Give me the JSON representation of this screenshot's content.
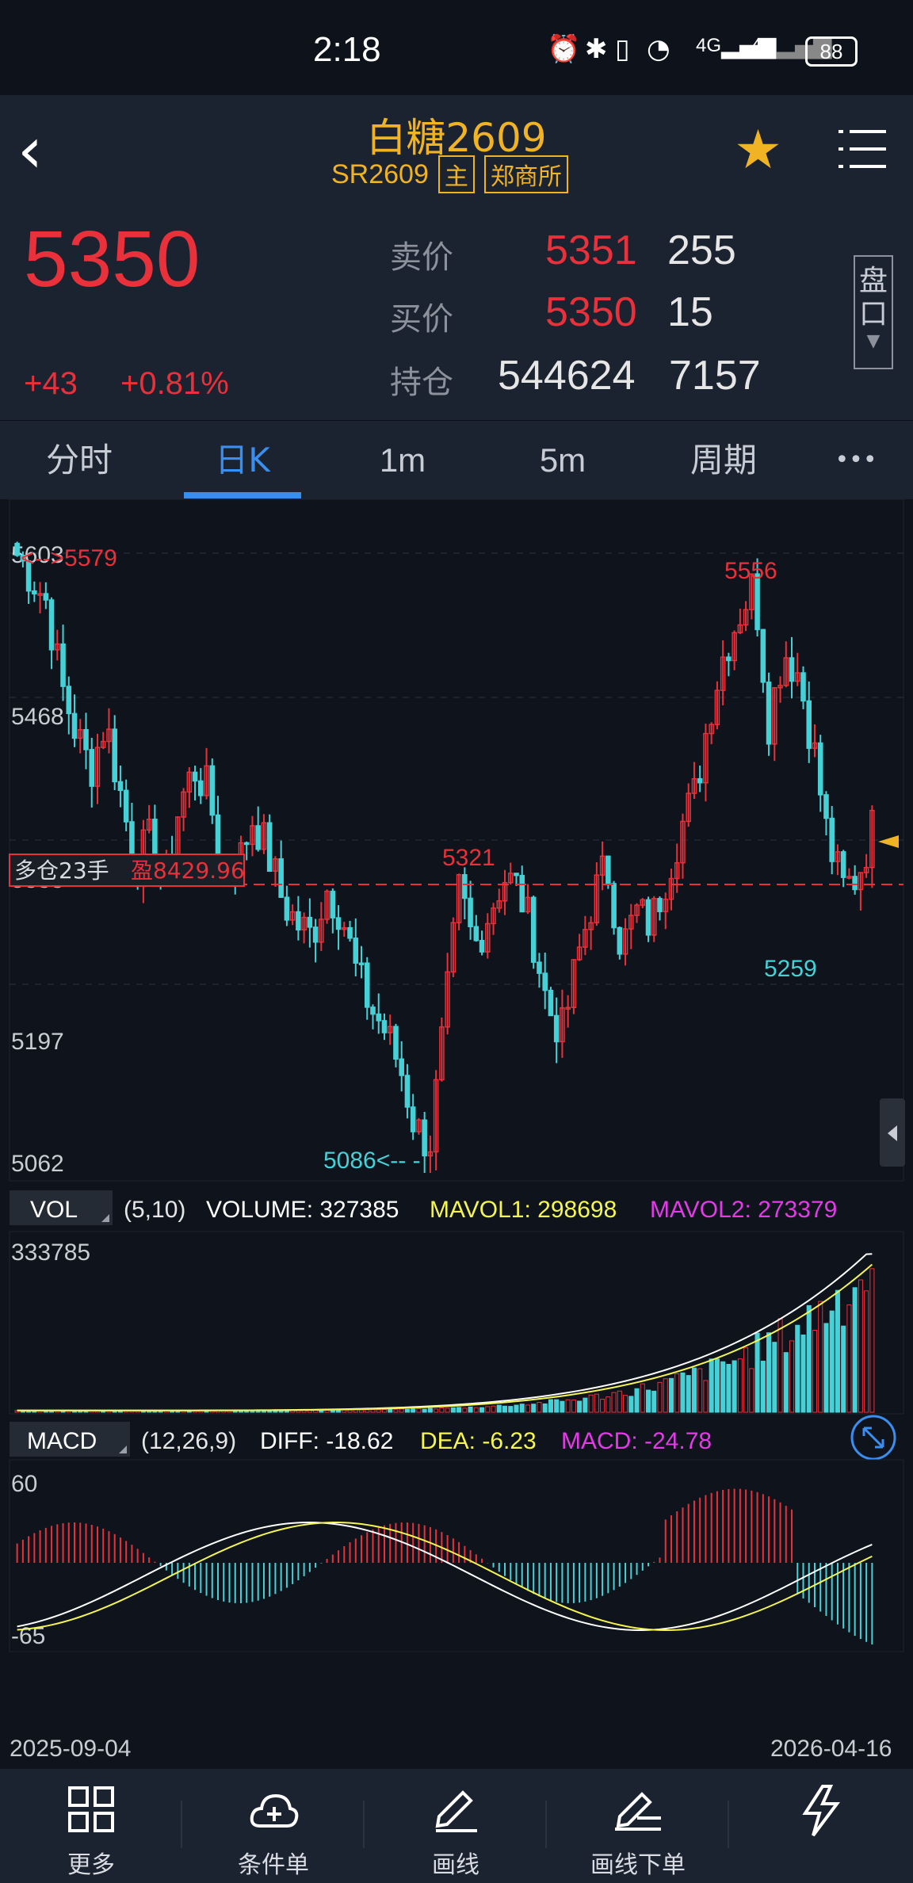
{
  "status_bar": {
    "time": "2:18",
    "battery": "88",
    "net1": "4G",
    "net2": "4G"
  },
  "header": {
    "title": "白糖2609",
    "code": "SR2609",
    "badge_main": "主",
    "badge_exchange": "郑商所",
    "last_price": "5350",
    "change": "+43",
    "change_pct": "+0.81%",
    "ask_label": "卖价",
    "ask_price": "5351",
    "ask_volume": "255",
    "bid_label": "买价",
    "bid_price": "5350",
    "bid_volume": "15",
    "oi_label": "持仓",
    "open_interest": "544624",
    "oi_change": "7157",
    "panel_button": "盘口"
  },
  "tabs": [
    "分时",
    "日K",
    "1m",
    "5m",
    "周期"
  ],
  "active_tab": "日K",
  "more_tabs": "•••",
  "price_panel": {
    "ticks": [
      "5603",
      "5468",
      "5333",
      "5197",
      "5062"
    ],
    "annotations": {
      "start_high": "<-->5579",
      "peak": "5556",
      "mid": "5321",
      "low": "5086<-- -",
      "recent_low": "5259"
    },
    "position_label": "多仓23手",
    "position_pnl": "盈8429.96"
  },
  "volume_panel": {
    "name": "VOL",
    "params": "(5,10)",
    "volume": "VOLUME: 327385",
    "mavol1": "MAVOL1: 298698",
    "mavol2": "MAVOL2: 273379",
    "max_tick": "333785"
  },
  "macd_panel": {
    "name": "MACD",
    "params": "(12,26,9)",
    "diff": "DIFF: -18.62",
    "dea": "DEA: -6.23",
    "macd": "MACD: -24.78",
    "top_tick": "60",
    "bottom_tick": "-65"
  },
  "date_range": {
    "start": "2025-09-04",
    "end": "2026-04-16"
  },
  "bottom_nav": [
    "更多",
    "条件单",
    "画线",
    "画线下单",
    ""
  ],
  "colors": {
    "up": "#e8313a",
    "down": "#46d1d6",
    "accent": "#f0b323",
    "tab_active": "#3a8ef0",
    "mavol1": "#f5f552",
    "mavol2": "#e43ae8"
  },
  "chart_data": {
    "type": "candlestick",
    "x_start": "2025-09-04",
    "x_end": "2026-04-16",
    "ylim": [
      5062,
      5603
    ],
    "close_path": [
      5579,
      5560,
      5540,
      5470,
      5430,
      5400,
      5440,
      5380,
      5320,
      5340,
      5300,
      5370,
      5400,
      5380,
      5310,
      5320,
      5360,
      5330,
      5290,
      5270,
      5260,
      5300,
      5280,
      5230,
      5200,
      5180,
      5150,
      5100,
      5086,
      5190,
      5300,
      5250,
      5280,
      5310,
      5300,
      5260,
      5200,
      5180,
      5240,
      5290,
      5320,
      5250,
      5280,
      5270,
      5310,
      5350,
      5380,
      5450,
      5500,
      5530,
      5556,
      5440,
      5500,
      5480,
      5420,
      5340,
      5300,
      5310,
      5350
    ],
    "volume_max": 333785,
    "macd_range": [
      -65,
      60
    ]
  }
}
